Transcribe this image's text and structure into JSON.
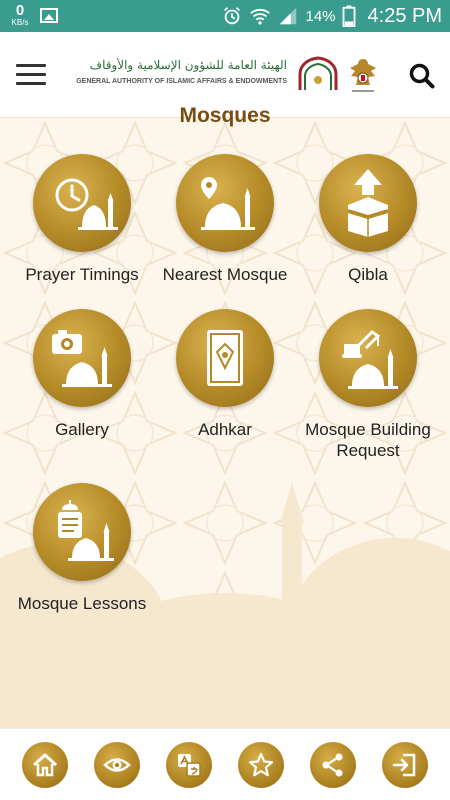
{
  "status_bar": {
    "speed_value": "0",
    "speed_unit": "KB/s",
    "battery_percent": "14%",
    "time": "4:25 PM"
  },
  "header": {
    "logo_arabic": "الهيئة العامة للشؤون الإسلامية والأوقاف",
    "logo_english": "GENERAL AUTHORITY OF ISLAMIC AFFAIRS & ENDOWMENTS"
  },
  "page": {
    "title": "Mosques"
  },
  "tiles": [
    {
      "label": "Prayer Timings",
      "icon": "clock-mosque-icon"
    },
    {
      "label": "Nearest Mosque",
      "icon": "location-mosque-icon"
    },
    {
      "label": "Qibla",
      "icon": "kaaba-arrow-icon"
    },
    {
      "label": "Gallery",
      "icon": "camera-mosque-icon"
    },
    {
      "label": "Adhkar",
      "icon": "quran-book-icon"
    },
    {
      "label": "Mosque Building Request",
      "icon": "crane-mosque-icon"
    },
    {
      "label": "Mosque Lessons",
      "icon": "lesson-mosque-icon"
    }
  ],
  "bottom_nav": [
    {
      "icon": "home-icon"
    },
    {
      "icon": "eye-icon"
    },
    {
      "icon": "language-icon"
    },
    {
      "icon": "star-icon"
    },
    {
      "icon": "share-icon"
    },
    {
      "icon": "exit-icon"
    }
  ],
  "colors": {
    "status_bar": "#3a9c8f",
    "gold": "#b48a27",
    "title_brown": "#7a4c12",
    "background": "#fdf6ea"
  }
}
